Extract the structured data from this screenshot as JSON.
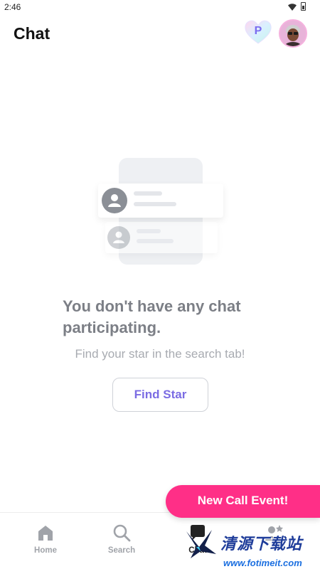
{
  "status_bar": {
    "time": "2:46"
  },
  "header": {
    "title": "Chat",
    "badge_letter": "P"
  },
  "empty_state": {
    "title": "You don't have any chat participating.",
    "subtitle": "Find your star in the search tab!",
    "button_label": "Find Star"
  },
  "nav": {
    "items": [
      {
        "label": "Home",
        "icon": "home-icon",
        "active": false
      },
      {
        "label": "Search",
        "icon": "search-icon",
        "active": false
      },
      {
        "label": "Chat",
        "icon": "chat-icon",
        "active": true
      },
      {
        "label": "",
        "icon": "star-person-icon",
        "active": false
      }
    ]
  },
  "event_banner": {
    "label": "New Call Event!",
    "color": "#ff2f87"
  },
  "watermark": {
    "text": "清源下载站",
    "url": "www.fotimeit.com"
  },
  "colors": {
    "accent": "#7b6ce3",
    "banner": "#ff2f87"
  }
}
